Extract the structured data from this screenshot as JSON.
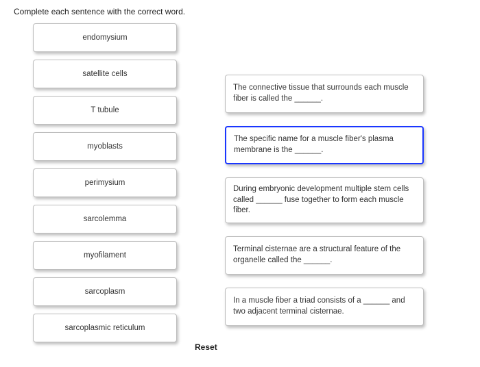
{
  "instruction": "Complete each sentence with the correct word.",
  "terms": [
    "endomysium",
    "satellite cells",
    "T tubule",
    "myoblasts",
    "perimysium",
    "sarcolemma",
    "myofilament",
    "sarcoplasm",
    "sarcoplasmic reticulum"
  ],
  "targets": [
    {
      "text": "The connective tissue that surrounds each muscle fiber is called the ______.",
      "selected": false
    },
    {
      "text": "The specific name for a muscle fiber's plasma membrane is the ______.",
      "selected": true
    },
    {
      "text": "During embryonic development multiple stem cells called ______ fuse together to form each muscle fiber.",
      "selected": false
    },
    {
      "text": "Terminal cisternae are a structural feature of the organelle called the ______.",
      "selected": false
    },
    {
      "text": "In a muscle fiber a triad consists of a ______ and two adjacent terminal cisternae.",
      "selected": false
    }
  ],
  "reset_label": "Reset"
}
